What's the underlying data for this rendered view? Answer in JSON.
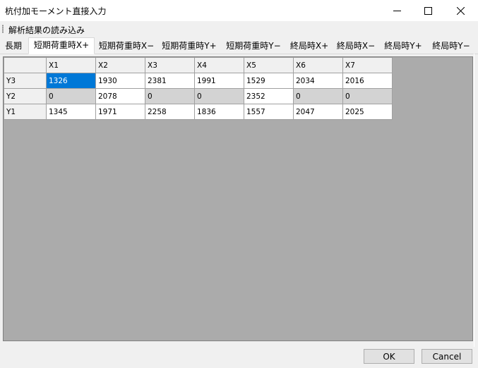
{
  "window": {
    "title": "杭付加モーメント直接入力"
  },
  "toolbar": {
    "load_label": "解析結果の読み込み"
  },
  "tabs": [
    {
      "label": "長期",
      "active": false
    },
    {
      "label": "短期荷重時X+",
      "active": true
    },
    {
      "label": "短期荷重時X−",
      "active": false
    },
    {
      "label": "短期荷重時Y+",
      "active": false
    },
    {
      "label": "短期荷重時Y−",
      "active": false
    },
    {
      "label": "終局時X+",
      "active": false
    },
    {
      "label": "終局時X−",
      "active": false
    },
    {
      "label": "終局時Y+",
      "active": false
    },
    {
      "label": "終局時Y−",
      "active": false
    }
  ],
  "grid": {
    "columns": [
      "X1",
      "X2",
      "X3",
      "X4",
      "X5",
      "X6",
      "X7"
    ],
    "rows": [
      {
        "label": "Y3",
        "values": [
          "1326",
          "1930",
          "2381",
          "1991",
          "1529",
          "2034",
          "2016"
        ]
      },
      {
        "label": "Y2",
        "values": [
          "0",
          "2078",
          "0",
          "0",
          "2352",
          "0",
          "0"
        ]
      },
      {
        "label": "Y1",
        "values": [
          "1345",
          "1971",
          "2258",
          "1836",
          "1557",
          "2047",
          "2025"
        ]
      }
    ]
  },
  "buttons": {
    "ok": "OK",
    "cancel": "Cancel"
  },
  "colors": {
    "selected_cell": "#0078d7",
    "disabled_cell": "#d3d3d3",
    "grid_background": "#ababab"
  }
}
